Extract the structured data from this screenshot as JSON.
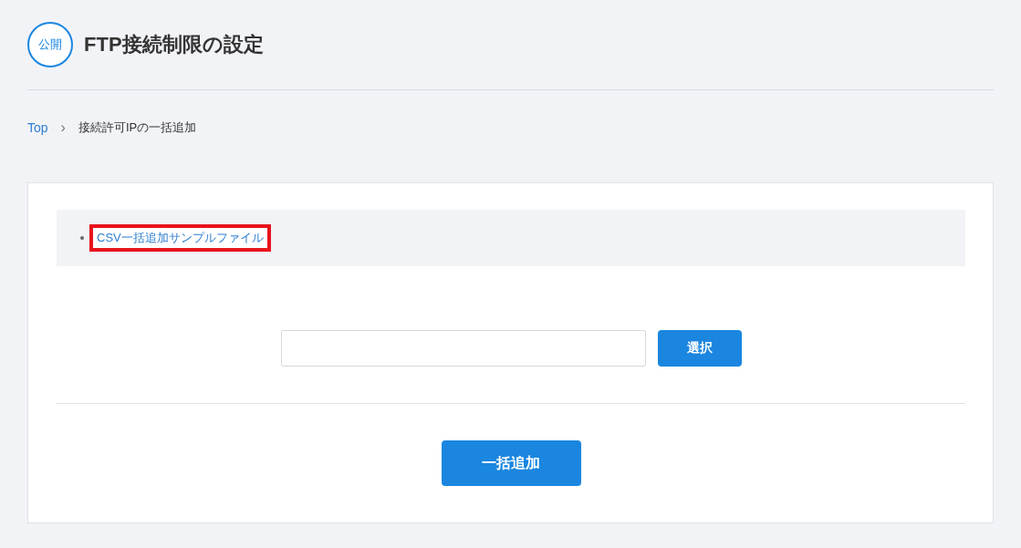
{
  "header": {
    "badge": "公開",
    "title": "FTP接続制限の設定"
  },
  "breadcrumb": [
    {
      "label": "Top",
      "link": true
    },
    {
      "label": "接続許可IPの一括追加",
      "link": false
    }
  ],
  "breadcrumb_separator": "›",
  "links": [
    {
      "label": "CSV一括追加サンプルファイル",
      "highlighted": true
    }
  ],
  "select_button": "選択",
  "submit_button": "一括追加"
}
